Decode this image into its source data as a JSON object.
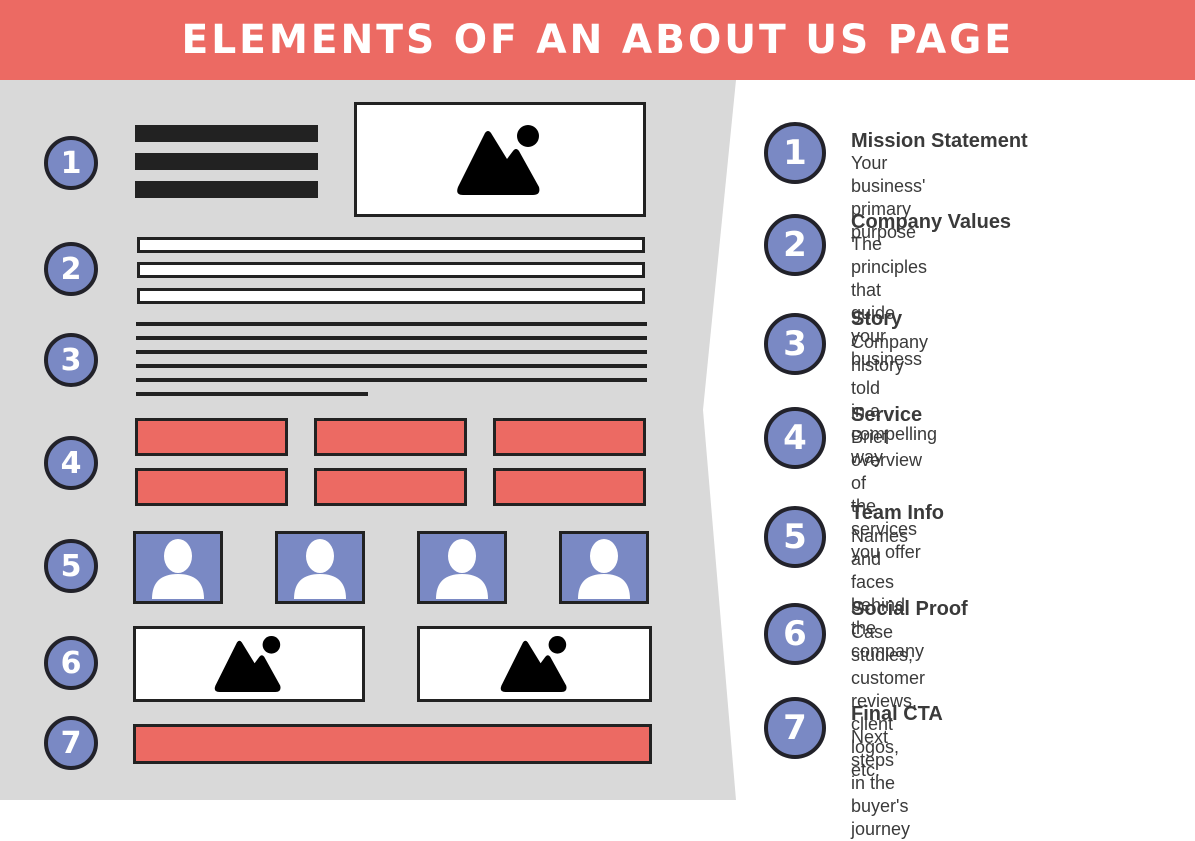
{
  "header": {
    "title": "ELEMENTS OF AN ABOUT US PAGE"
  },
  "colors": {
    "accent_red": "#ec6a63",
    "badge_blue": "#7a89c4",
    "panel_gray": "#d9d9d9",
    "ink": "#222222"
  },
  "wireframe": {
    "markers": [
      "1",
      "2",
      "3",
      "4",
      "5",
      "6",
      "7"
    ],
    "sections": [
      {
        "number": "1",
        "content": "heading bars + hero image",
        "icon": "image-icon"
      },
      {
        "number": "2",
        "content": "three outlined bars"
      },
      {
        "number": "3",
        "content": "paragraph text lines"
      },
      {
        "number": "4",
        "content": "six service boxes"
      },
      {
        "number": "5",
        "content": "four team avatars",
        "icon": "user-icon"
      },
      {
        "number": "6",
        "content": "two proof images",
        "icon": "image-icon"
      },
      {
        "number": "7",
        "content": "call-to-action bar"
      }
    ]
  },
  "legend": [
    {
      "number": "1",
      "title": "Mission Statement",
      "desc": "Your business' primary purpose"
    },
    {
      "number": "2",
      "title": "Company Values",
      "desc": "The principles that guide\nyour business"
    },
    {
      "number": "3",
      "title": "Story",
      "desc": "Company history told\nin a compelling way"
    },
    {
      "number": "4",
      "title": "Service",
      "desc": "Brief overview of\nthe services you offer"
    },
    {
      "number": "5",
      "title": "Team Info",
      "desc": "Names and faces behind\nthe company"
    },
    {
      "number": "6",
      "title": "Social Proof",
      "desc": "Case studies, customer reviews,\nclient logos, etc."
    },
    {
      "number": "7",
      "title": "Final CTA",
      "desc": "Next steps in the buyer's journey"
    }
  ]
}
